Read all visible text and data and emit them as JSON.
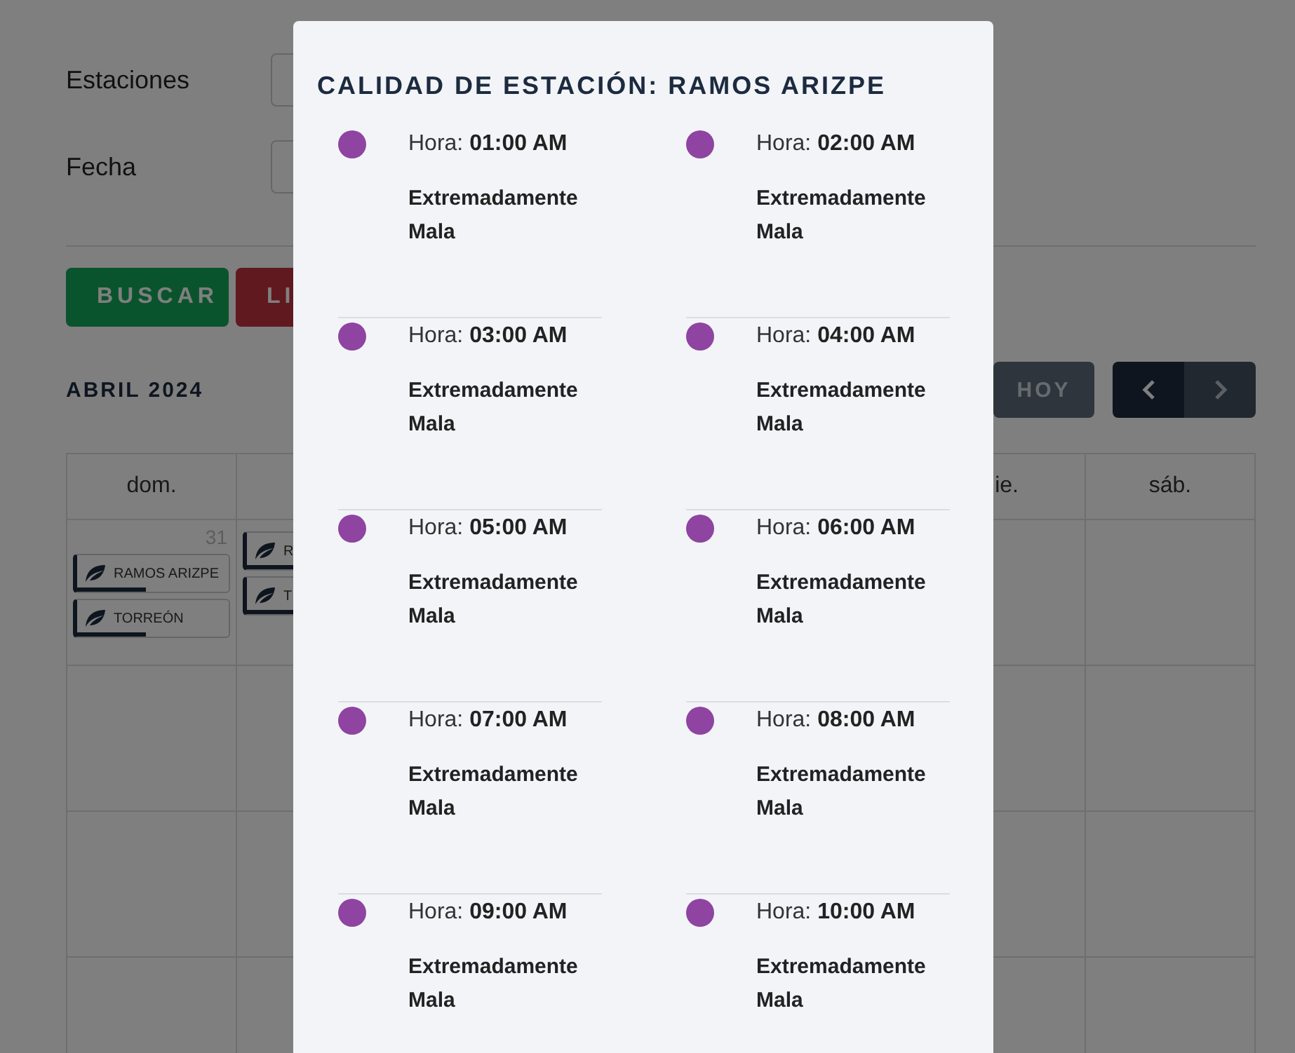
{
  "filters": [
    {
      "label": "Estaciones"
    },
    {
      "label": "Fecha"
    }
  ],
  "buttons": [
    {
      "label": "BUSCAR",
      "kind": "primary"
    },
    {
      "label": "LI",
      "kind": "danger"
    }
  ],
  "calendar": {
    "title": "ABRIL 2024",
    "today_button": "HOY",
    "headers": [
      {
        "label": "dom."
      },
      {
        "label": "ie."
      },
      {
        "label": "sáb."
      }
    ],
    "first_day": "31",
    "events": [
      [
        {
          "label": "RAMOS ARIZPE"
        },
        {
          "label": "TORREÓN"
        }
      ],
      [
        {
          "label": "R"
        },
        {
          "label": "T"
        }
      ]
    ]
  },
  "modal": {
    "title": "CALIDAD DE ESTACIÓN: RAMOS ARIZPE",
    "readings": [
      {
        "hour_label": "Hora:",
        "time": "01:00 AM",
        "quality": "Extremadamente Mala",
        "color": "#8e44a0"
      },
      {
        "hour_label": "Hora:",
        "time": "02:00 AM",
        "quality": "Extremadamente Mala",
        "color": "#8e44a0"
      },
      {
        "hour_label": "Hora:",
        "time": "03:00 AM",
        "quality": "Extremadamente Mala",
        "color": "#8e44a0"
      },
      {
        "hour_label": "Hora:",
        "time": "04:00 AM",
        "quality": "Extremadamente Mala",
        "color": "#8e44a0"
      },
      {
        "hour_label": "Hora:",
        "time": "05:00 AM",
        "quality": "Extremadamente Mala",
        "color": "#8e44a0"
      },
      {
        "hour_label": "Hora:",
        "time": "06:00 AM",
        "quality": "Extremadamente Mala",
        "color": "#8e44a0"
      },
      {
        "hour_label": "Hora:",
        "time": "07:00 AM",
        "quality": "Extremadamente Mala",
        "color": "#8e44a0"
      },
      {
        "hour_label": "Hora:",
        "time": "08:00 AM",
        "quality": "Extremadamente Mala",
        "color": "#8e44a0"
      },
      {
        "hour_label": "Hora:",
        "time": "09:00 AM",
        "quality": "Extremadamente Mala",
        "color": "#8e44a0"
      },
      {
        "hour_label": "Hora:",
        "time": "10:00 AM",
        "quality": "Extremadamente Mala",
        "color": "#8e44a0"
      }
    ]
  }
}
